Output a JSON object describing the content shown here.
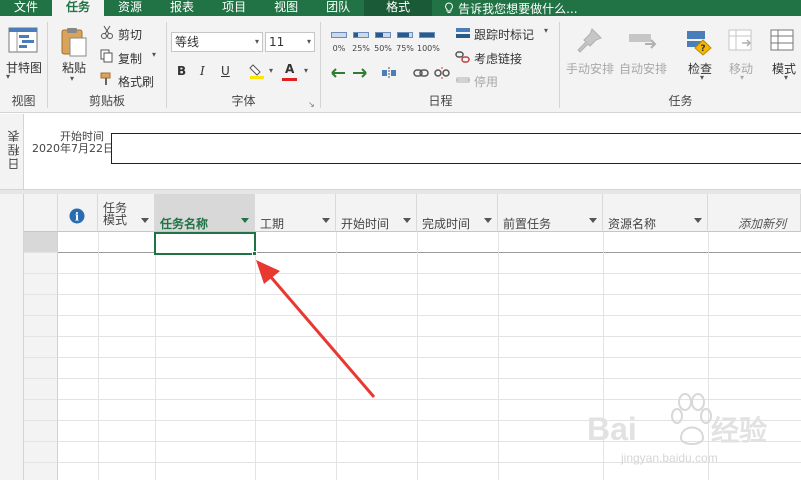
{
  "tabs": [
    {
      "label": "文件"
    },
    {
      "label": "任务"
    },
    {
      "label": "资源"
    },
    {
      "label": "报表"
    },
    {
      "label": "项目"
    },
    {
      "label": "视图"
    },
    {
      "label": "团队"
    },
    {
      "label": "格式"
    }
  ],
  "tell_me": "告诉我您想要做什么...",
  "ribbon": {
    "view": {
      "gantt_label": "甘特图",
      "group_label": "视图"
    },
    "clipboard": {
      "paste_label": "粘贴",
      "cut_label": "剪切",
      "copy_label": "复制",
      "format_painter_label": "格式刷",
      "group_label": "剪贴板"
    },
    "font": {
      "font_name": "等线",
      "font_size": "11",
      "bold": "B",
      "italic": "I",
      "underline": "U",
      "font_color_glyph": "A",
      "group_label": "字体"
    },
    "schedule": {
      "percent_buttons": [
        "0%",
        "25%",
        "50%",
        "75%",
        "100%"
      ],
      "mark_on_track_label": "跟踪时标记",
      "respect_links_label": "考虑链接",
      "inactivate_label": "停用",
      "group_label": "日程"
    },
    "tasks": {
      "manual_label": "手动安排",
      "auto_label": "自动安排",
      "inspect_label": "检查",
      "move_label": "移动",
      "mode_label": "模式",
      "group_label": "任务"
    }
  },
  "timeline": {
    "side_label": "日程表",
    "start_label": "开始时间",
    "start_date": "2020年7月22日"
  },
  "grid": {
    "columns": [
      {
        "label": ""
      },
      {
        "label": "任务\n模式"
      },
      {
        "label": "任务名称"
      },
      {
        "label": "工期"
      },
      {
        "label": "开始时间"
      },
      {
        "label": "完成时间"
      },
      {
        "label": "前置任务"
      },
      {
        "label": "资源名称"
      },
      {
        "label": "添加新列"
      }
    ],
    "info_glyph": "i"
  },
  "watermark": {
    "brand": "Bai",
    "brand2": "经验",
    "site": "jingyan.baidu.com"
  },
  "colors": {
    "accent": "#217346",
    "arrow": "#e8382f"
  }
}
